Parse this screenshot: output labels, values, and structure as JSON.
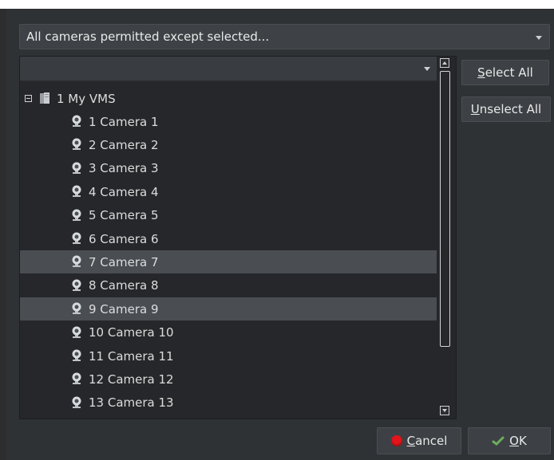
{
  "permission_select": {
    "value": "All cameras permitted except selected..."
  },
  "filter": {
    "value": ""
  },
  "tree": {
    "root_label": "1 My VMS",
    "cameras": [
      {
        "label": "1 Camera 1",
        "selected": false
      },
      {
        "label": "2 Camera 2",
        "selected": false
      },
      {
        "label": "3 Camera 3",
        "selected": false
      },
      {
        "label": "4 Camera 4",
        "selected": false
      },
      {
        "label": "5 Camera 5",
        "selected": false
      },
      {
        "label": "6 Camera 6",
        "selected": false
      },
      {
        "label": "7 Camera 7",
        "selected": true
      },
      {
        "label": "8 Camera 8",
        "selected": false
      },
      {
        "label": "9 Camera 9",
        "selected": true
      },
      {
        "label": "10 Camera 10",
        "selected": false
      },
      {
        "label": "11 Camera 11",
        "selected": false
      },
      {
        "label": "12 Camera 12",
        "selected": false
      },
      {
        "label": "13 Camera 13",
        "selected": false
      }
    ]
  },
  "buttons": {
    "select_all": {
      "mnemonic": "S",
      "rest": "elect All"
    },
    "unselect_all": {
      "mnemonic": "U",
      "rest": "nselect All"
    },
    "cancel": {
      "mnemonic": "C",
      "rest": "ancel"
    },
    "ok": {
      "mnemonic": "O",
      "rest": "K"
    }
  },
  "colors": {
    "selected_row": "#4a4e53",
    "cancel_icon": "#e3141b",
    "ok_icon": "#5aa05a"
  },
  "icons": {
    "root": "server-icon",
    "camera": "webcam-icon",
    "cancel": "red-dot-icon",
    "ok": "checkmark-icon"
  }
}
